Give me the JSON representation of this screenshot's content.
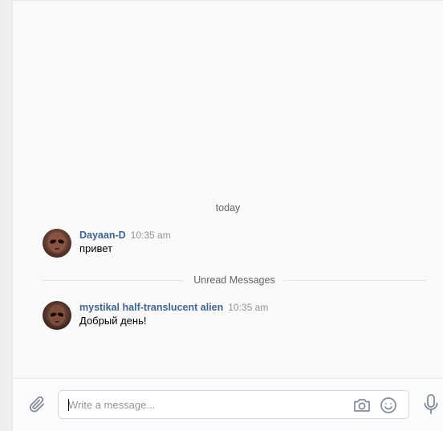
{
  "chat": {
    "date_separator": "today",
    "messages": [
      {
        "author": "Dayaan-D",
        "time": "10:35 am",
        "text": "привет"
      },
      {
        "author": "mystikal half-translucent alien",
        "time": "10:35 am",
        "text": "Добрый день!"
      }
    ],
    "unread_label": "Unread Messages"
  },
  "composer": {
    "placeholder": "Write a message...",
    "icons": [
      "paperclip-icon",
      "camera-icon",
      "smiley-icon",
      "microphone-icon"
    ]
  },
  "colors": {
    "author_link": "#42648b",
    "meta_gray": "#939393",
    "icon_gray": "#828a99",
    "background": "#f9f9fa"
  }
}
